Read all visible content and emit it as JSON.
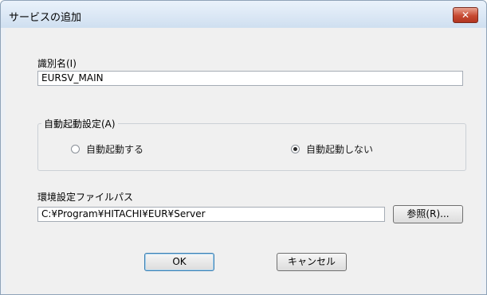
{
  "window": {
    "title": "サービスの追加",
    "close_glyph": "✕"
  },
  "fields": {
    "identifier": {
      "label": "識別名(I)",
      "value": "EURSV_MAIN"
    },
    "env_path": {
      "label": "環境設定ファイルパス",
      "value": "C:¥Program¥HITACHI¥EUR¥Server"
    }
  },
  "autostart": {
    "legend": "自動起動設定(A)",
    "options": [
      {
        "label": "自動起動する",
        "checked": false
      },
      {
        "label": "自動起動しない",
        "checked": true
      }
    ]
  },
  "buttons": {
    "browse": "参照(R)...",
    "ok": "OK",
    "cancel": "キャンセル"
  },
  "colors": {
    "title_bar": "#cfdff0",
    "close_button": "#c74a32",
    "dialog_background": "#f0f0f0"
  },
  "icons": {
    "close": "close-icon"
  }
}
